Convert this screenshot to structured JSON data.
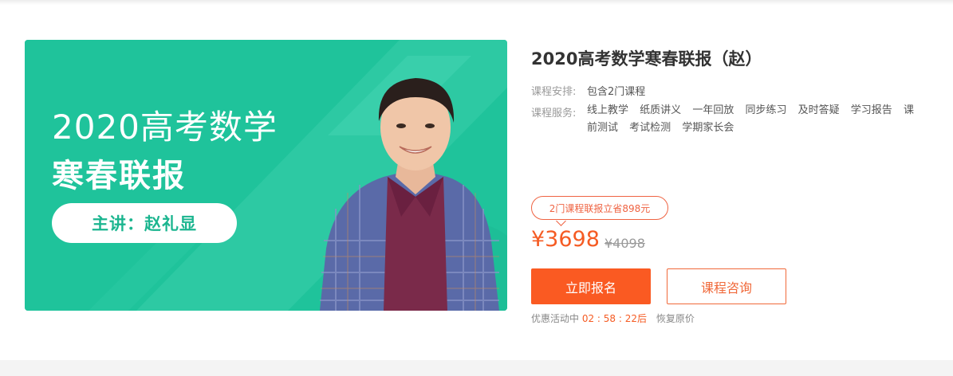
{
  "banner": {
    "title_line1": "2020高考数学",
    "title_line2": "寒春联报",
    "teacher_label": "主讲：赵礼显",
    "bg_color": "#1fc39b"
  },
  "course": {
    "title": "2020高考数学寒春联报（赵）",
    "schedule_label": "课程安排:",
    "schedule_value": "包含2门课程",
    "services_label": "课程服务:",
    "services": [
      "线上教学",
      "纸质讲义",
      "一年回放",
      "同步练习",
      "及时答疑",
      "学习报告",
      "课前测试",
      "考试检测",
      "学期家长会"
    ]
  },
  "pricing": {
    "promo_badge": "2门课程联报立省898元",
    "current_price": "¥3698",
    "original_price": "¥4098",
    "accent_color": "#f55b23"
  },
  "actions": {
    "enroll_label": "立即报名",
    "consult_label": "课程咨询"
  },
  "countdown": {
    "prefix": "优惠活动中",
    "time": "02 : 58 : 22后",
    "suffix": "恢复原价"
  }
}
